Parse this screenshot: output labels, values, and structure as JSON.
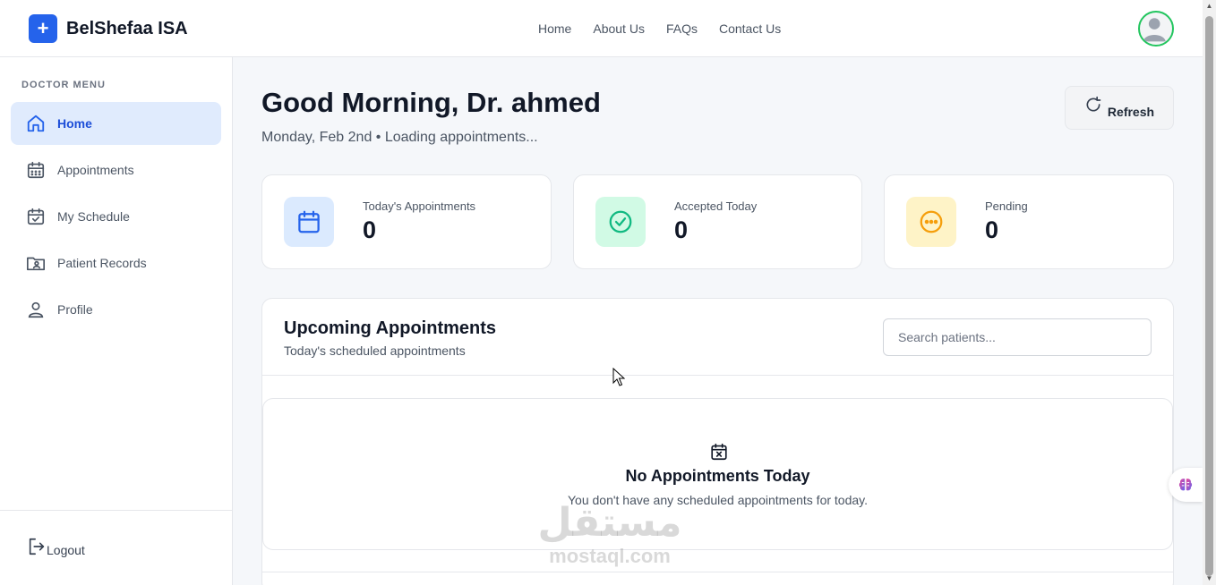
{
  "brand": {
    "logo_glyph": "+",
    "name": "BelShefaa ISA",
    "color": "#2563eb"
  },
  "topnav": {
    "items": [
      "Home",
      "About Us",
      "FAQs",
      "Contact Us"
    ]
  },
  "sidebar": {
    "title": "DOCTOR MENU",
    "items": [
      {
        "label": "Home",
        "icon": "home-icon",
        "active": true
      },
      {
        "label": "Appointments",
        "icon": "calendar-icon",
        "active": false
      },
      {
        "label": "My Schedule",
        "icon": "calendar-check-icon",
        "active": false
      },
      {
        "label": "Patient Records",
        "icon": "folder-user-icon",
        "active": false
      },
      {
        "label": "Profile",
        "icon": "user-icon",
        "active": false
      }
    ],
    "logout_label": "Logout"
  },
  "main": {
    "greeting": "Good Morning, Dr. ahmed",
    "subtitle": "Monday, Feb 2nd • Loading appointments...",
    "refresh_label": "Refresh"
  },
  "stats": [
    {
      "label": "Today's Appointments",
      "value": "0",
      "icon": "calendar-icon",
      "bg": "#dbeafe",
      "fg": "#2563eb"
    },
    {
      "label": "Accepted Today",
      "value": "0",
      "icon": "check-circle-icon",
      "bg": "#d1fae5",
      "fg": "#10b981"
    },
    {
      "label": "Pending",
      "value": "0",
      "icon": "dots-circle-icon",
      "bg": "#fef3c7",
      "fg": "#f59e0b"
    }
  ],
  "upcoming": {
    "title": "Upcoming Appointments",
    "subtitle": "Today's scheduled appointments",
    "search_placeholder": "Search patients...",
    "empty_title": "No Appointments Today",
    "empty_subtitle": "You don't have any scheduled appointments for today."
  },
  "watermark": {
    "arabic": "مستقل",
    "latin": "mostaql.com"
  }
}
